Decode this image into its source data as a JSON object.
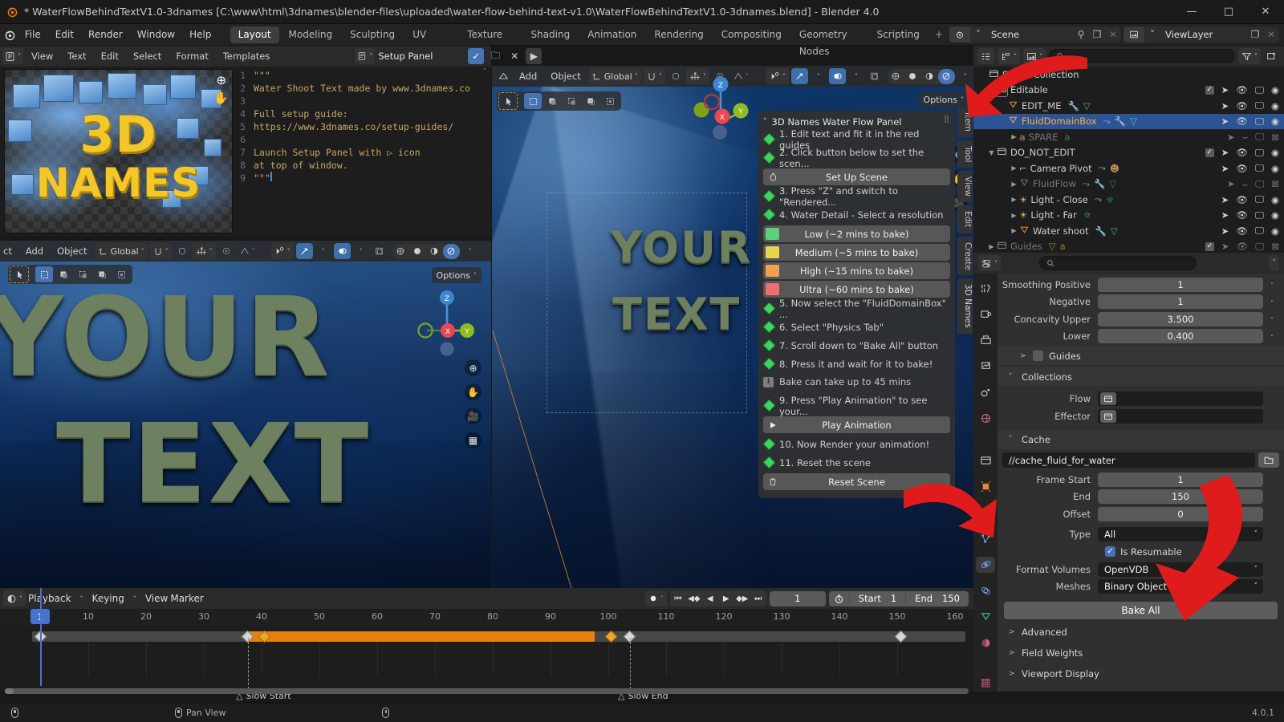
{
  "titlebar": {
    "title": "* WaterFlowBehindTextV1.0-3dnames [C:\\www\\html\\3dnames\\blender-files\\uploaded\\water-flow-behind-text-v1.0\\WaterFlowBehindTextV1.0-3dnames.blend] - Blender 4.0",
    "minimize": "—",
    "maximize": "□",
    "close": "✕"
  },
  "topbar": {
    "menus": [
      "File",
      "Edit",
      "Render",
      "Window",
      "Help"
    ],
    "workspaces": [
      "Layout",
      "Modeling",
      "Sculpting",
      "UV Editing",
      "Texture Paint",
      "Shading",
      "Animation",
      "Rendering",
      "Compositing",
      "Geometry Nodes",
      "Scripting"
    ],
    "active_workspace": "Layout",
    "add_workspace": "+",
    "scene_name": "Scene",
    "viewlayer_name": "ViewLayer"
  },
  "text_editor": {
    "menus": [
      "View",
      "Text",
      "Edit",
      "Select",
      "Format",
      "Templates"
    ],
    "datablock_name": "Setup Panel",
    "lines": [
      {
        "n": "1",
        "t": "\"\"\""
      },
      {
        "n": "2",
        "t": "Water Shoot Text made by www.3dnames.co"
      },
      {
        "n": "3",
        "t": ""
      },
      {
        "n": "4",
        "t": "Full setup guide:"
      },
      {
        "n": "5",
        "t": "https://www.3dnames.co/setup-guides/"
      },
      {
        "n": "6",
        "t": ""
      },
      {
        "n": "7",
        "t": "Launch Setup Panel with ▷ icon"
      },
      {
        "n": "8",
        "t": "at top of window."
      },
      {
        "n": "9",
        "t": "\"\"\""
      }
    ],
    "thumbnail": {
      "word1": "3D",
      "word2": "NAMES"
    }
  },
  "viewport_top": {
    "menus": [
      "Add",
      "Object"
    ],
    "transform_orientation": "Global",
    "options_label": "Options",
    "gizmo_axes": [
      "Z",
      "X",
      "Y"
    ]
  },
  "viewport_bottom": {
    "menus": [
      "ct",
      "Add",
      "Object"
    ],
    "transform_orientation": "Global",
    "options_label": "Options",
    "gizmo_axes": [
      "Z",
      "X",
      "Y"
    ],
    "scene_text_line1": "YOUR",
    "scene_text_line2": "TEXT"
  },
  "nfpanel": {
    "title": "3D Names Water Flow Panel",
    "steps": [
      {
        "kind": "step",
        "text": "1. Edit text and fit it in the red guides"
      },
      {
        "kind": "step",
        "text": "2. Click button below to set the scen..."
      },
      {
        "kind": "button",
        "text": "Set Up Scene",
        "icon": "droplet-icon"
      },
      {
        "kind": "step",
        "text": "3. Press \"Z\" and switch to \"Rendered..."
      },
      {
        "kind": "step",
        "text": "4. Water Detail - Select a resolution"
      },
      {
        "kind": "swatch",
        "text": "Low (~2 mins to bake)",
        "color": "#5ed07a"
      },
      {
        "kind": "swatch",
        "text": "Medium (~5 mins to bake)",
        "color": "#ead34f"
      },
      {
        "kind": "swatch",
        "text": "High (~15 mins to bake)",
        "color": "#f0a050"
      },
      {
        "kind": "swatch",
        "text": "Ultra (~60 mins to bake)",
        "color": "#ef6f6f"
      },
      {
        "kind": "step",
        "text": "5. Now select the \"FluidDomainBox\" ..."
      },
      {
        "kind": "step",
        "text": "6. Select \"Physics Tab\""
      },
      {
        "kind": "step",
        "text": "7. Scroll down to \"Bake All\" button"
      },
      {
        "kind": "step",
        "text": "8. Press it and wait for it to bake!"
      },
      {
        "kind": "info",
        "text": "Bake can take up to 45 mins"
      },
      {
        "kind": "step",
        "text": "9. Press \"Play Animation\" to see your..."
      },
      {
        "kind": "button",
        "text": "Play Animation",
        "icon": "play-icon"
      },
      {
        "kind": "step",
        "text": "10. Now Render your animation!"
      },
      {
        "kind": "step",
        "text": "11. Reset the scene"
      },
      {
        "kind": "button",
        "text": "Reset Scene",
        "icon": "trash-icon"
      }
    ]
  },
  "npanel_tabs": [
    "Item",
    "Tool",
    "View",
    "Edit",
    "Create",
    "3D Names"
  ],
  "outliner": {
    "search_placeholder": "",
    "rows": [
      {
        "indent": 0,
        "tri": "",
        "name": "Scene Collection",
        "icon": "collection-icon",
        "dim": false,
        "sel": false,
        "checkbox": false,
        "rightcols": []
      },
      {
        "indent": 1,
        "tri": "▼",
        "name": "Editable",
        "icon": "collection-icon",
        "dim": false,
        "sel": false,
        "checkbox": true,
        "rightcols": [
          "cursor",
          "eye",
          "screen",
          "camera"
        ]
      },
      {
        "indent": 2,
        "tri": "",
        "name": "EDIT_ME",
        "icon": "mesh-icon",
        "dim": false,
        "sel": false,
        "checkbox": false,
        "mods": [
          "wrench",
          "mesh-data"
        ],
        "rightcols": [
          "cursor",
          "eye",
          "screen",
          "camera"
        ]
      },
      {
        "indent": 2,
        "tri": "",
        "name": "FluidDomainBox",
        "icon": "mesh-icon",
        "dim": false,
        "sel": true,
        "checkbox": false,
        "mods": [
          "physics",
          "wrench",
          "mesh-data"
        ],
        "rightcols": [
          "cursor",
          "eye",
          "screen",
          "camera"
        ]
      },
      {
        "indent": 3,
        "tri": "▶",
        "name": "SPARE",
        "icon": "font-icon",
        "dim": true,
        "sel": false,
        "checkbox": false,
        "mods": [
          "font-data"
        ],
        "rightcols": [
          "cursor",
          "eye-closed",
          "screen",
          "camera-off"
        ]
      },
      {
        "indent": 1,
        "tri": "▼",
        "name": "DO_NOT_EDIT",
        "icon": "collection-icon",
        "dim": false,
        "sel": false,
        "checkbox": true,
        "rightcols": [
          "cursor",
          "eye",
          "screen",
          "camera"
        ]
      },
      {
        "indent": 2,
        "tri": "▶",
        "name": "Camera Pivot",
        "icon": "empty-icon",
        "dim": false,
        "sel": false,
        "checkbox": false,
        "mods": [
          "physics",
          "monkey"
        ],
        "rightcols": [
          "cursor",
          "eye",
          "screen",
          "camera"
        ]
      },
      {
        "indent": 2,
        "tri": "▶",
        "name": "FluidFlow",
        "icon": "mesh-icon",
        "dim": true,
        "sel": false,
        "checkbox": false,
        "mods": [
          "physics",
          "wrench",
          "mesh-data"
        ],
        "rightcols": [
          "cursor",
          "eye-closed",
          "screen",
          "camera-off"
        ]
      },
      {
        "indent": 2,
        "tri": "▶",
        "name": "Light - Close",
        "icon": "light-icon",
        "dim": false,
        "sel": false,
        "checkbox": false,
        "mods": [
          "physics",
          "light-data"
        ],
        "rightcols": [
          "cursor",
          "eye",
          "screen",
          "camera"
        ]
      },
      {
        "indent": 2,
        "tri": "▶",
        "name": "Light - Far",
        "icon": "light-icon",
        "dim": false,
        "sel": false,
        "checkbox": false,
        "mods": [
          "light-data"
        ],
        "rightcols": [
          "cursor",
          "eye",
          "screen",
          "camera"
        ]
      },
      {
        "indent": 2,
        "tri": "▶",
        "name": "Water shoot",
        "icon": "mesh-icon",
        "dim": false,
        "sel": false,
        "checkbox": false,
        "mods": [
          "wrench",
          "mesh-data"
        ],
        "rightcols": [
          "cursor",
          "eye",
          "screen",
          "camera"
        ]
      },
      {
        "indent": 1,
        "tri": "▶",
        "name": "Guides",
        "icon": "collection-icon",
        "dim": true,
        "sel": false,
        "checkbox": true,
        "mods": [
          "mesh-icon",
          "font-icon"
        ],
        "rightcols": [
          "cursor",
          "eye",
          "screen",
          "camera-off"
        ]
      }
    ]
  },
  "properties": {
    "search_placeholder": "",
    "fields": [
      {
        "label": "Smoothing Positive",
        "value": "1"
      },
      {
        "label": "Negative",
        "value": "1"
      },
      {
        "label": "Concavity Upper",
        "value": "3.500"
      },
      {
        "label": "Lower",
        "value": "0.400"
      }
    ],
    "guides_section": "Guides",
    "collections_section": "Collections",
    "collections": [
      {
        "label": "Flow",
        "value": ""
      },
      {
        "label": "Effector",
        "value": ""
      }
    ],
    "cache_section": "Cache",
    "cache_path": "//cache_fluid_for_water",
    "cache_fields": [
      {
        "label": "Frame Start",
        "value": "1"
      },
      {
        "label": "End",
        "value": "150"
      },
      {
        "label": "Offset",
        "value": "0"
      }
    ],
    "type_label": "Type",
    "type_value": "All",
    "is_resumable_label": "Is Resumable",
    "format_volumes_label": "Format Volumes",
    "format_volumes_value": "OpenVDB",
    "meshes_label": "Meshes",
    "meshes_value": "Binary Object",
    "bake_all_label": "Bake All",
    "sections": [
      "Advanced",
      "Field Weights",
      "Viewport Display"
    ]
  },
  "timeline": {
    "menus": [
      "Playback",
      "Keying",
      "View",
      "Marker"
    ],
    "current_frame": "1",
    "start_label": "Start",
    "start_value": "1",
    "end_label": "End",
    "end_value": "150",
    "ruler_ticks": [
      "10",
      "20",
      "30",
      "40",
      "50",
      "60",
      "70",
      "80",
      "90",
      "100",
      "110",
      "120",
      "130",
      "140",
      "150",
      "160"
    ],
    "playhead_frame": "1",
    "markers": [
      {
        "label": "Slow Start",
        "frame": 37
      },
      {
        "label": "Slow End",
        "frame": 103
      }
    ],
    "keyframes": [
      1,
      37,
      40,
      100,
      103,
      150
    ],
    "selected_keyframes": [
      40,
      100
    ],
    "bar_start": 40,
    "bar_end": 100
  },
  "status": {
    "items": [
      "",
      "Pan View",
      ""
    ],
    "version": "4.0.1"
  },
  "colors": {
    "accent_blue": "#4772b3",
    "selection_orange": "#ffb13b",
    "keyframe_orange": "#e8820c",
    "arrow_red": "#e01b1b",
    "green_step": "#3fd45f"
  }
}
